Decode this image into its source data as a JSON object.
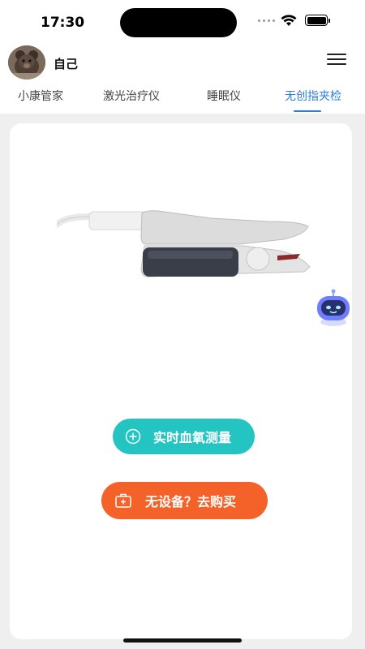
{
  "status_bar": {
    "time": "17:30"
  },
  "header": {
    "user_name": "自己"
  },
  "tabs": [
    {
      "label": "小康管家",
      "active": false
    },
    {
      "label": "激光治疗仪",
      "active": false
    },
    {
      "label": "睡眠仪",
      "active": false
    },
    {
      "label": "无创指夹检",
      "active": true
    }
  ],
  "buttons": {
    "measure_label": "实时血氧测量",
    "buy_label": "无设备？去购买"
  },
  "icons": {
    "menu": "hamburger-icon",
    "measure": "plus-circle-icon",
    "buy": "medical-kit-icon",
    "assistant": "robot-icon"
  },
  "colors": {
    "accent": "#2a7de1",
    "measure_button": "#23c4c2",
    "buy_button": "#f4622a"
  }
}
